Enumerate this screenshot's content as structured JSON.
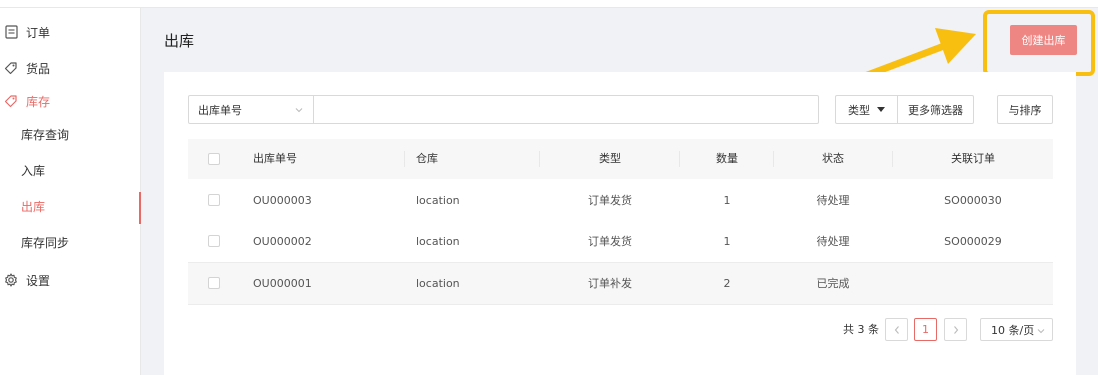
{
  "sidebar": {
    "items": [
      {
        "label": "订单",
        "icon": "receipt-icon"
      },
      {
        "label": "货品",
        "icon": "tag-icon"
      },
      {
        "label": "库存",
        "icon": "tag-icon"
      },
      {
        "label": "设置",
        "icon": "gear-icon"
      }
    ],
    "sub_items": [
      {
        "label": "库存查询"
      },
      {
        "label": "入库"
      },
      {
        "label": "出库"
      },
      {
        "label": "库存同步"
      }
    ]
  },
  "header": {
    "title": "出库",
    "create_button": "创建出库"
  },
  "toolbar": {
    "select_value": "出库单号",
    "search_value": "",
    "type_button": "类型",
    "filter_button": "更多筛选器",
    "sort_button": "与排序"
  },
  "table": {
    "columns": [
      "出库单号",
      "仓库",
      "类型",
      "数量",
      "状态",
      "关联订单"
    ],
    "rows": [
      {
        "id": "OU000003",
        "warehouse": "location",
        "type": "订单发货",
        "qty": "1",
        "status": "待处理",
        "order": "SO000030"
      },
      {
        "id": "OU000002",
        "warehouse": "location",
        "type": "订单发货",
        "qty": "1",
        "status": "待处理",
        "order": "SO000029"
      },
      {
        "id": "OU000001",
        "warehouse": "location",
        "type": "订单补发",
        "qty": "2",
        "status": "已完成",
        "order": ""
      }
    ]
  },
  "pagination": {
    "total": "共 3 条",
    "current_page": "1",
    "page_size": "10 条/页"
  },
  "colors": {
    "accent": "#e86a66",
    "highlight": "#f8bf11"
  }
}
